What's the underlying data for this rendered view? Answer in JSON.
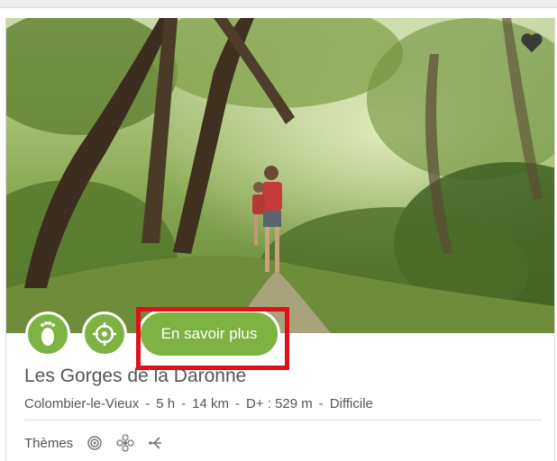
{
  "hike": {
    "title": "Les Gorges de la Daronne",
    "location": "Colombier-le-Vieux",
    "duration": "5 h",
    "distance": "14 km",
    "elevation": "D+ : 529 m",
    "difficulty": "Difficile"
  },
  "actions": {
    "more_label": "En savoir plus",
    "hike_icon": "footprint-icon",
    "locate_icon": "target-icon",
    "favorite_icon": "heart-icon"
  },
  "themes": {
    "label": "Thèmes",
    "icons": [
      "spiral-icon",
      "flower-icon",
      "bird-icon"
    ]
  },
  "colors": {
    "accent_green": "#7cb342",
    "highlight_red": "#e0101a"
  }
}
